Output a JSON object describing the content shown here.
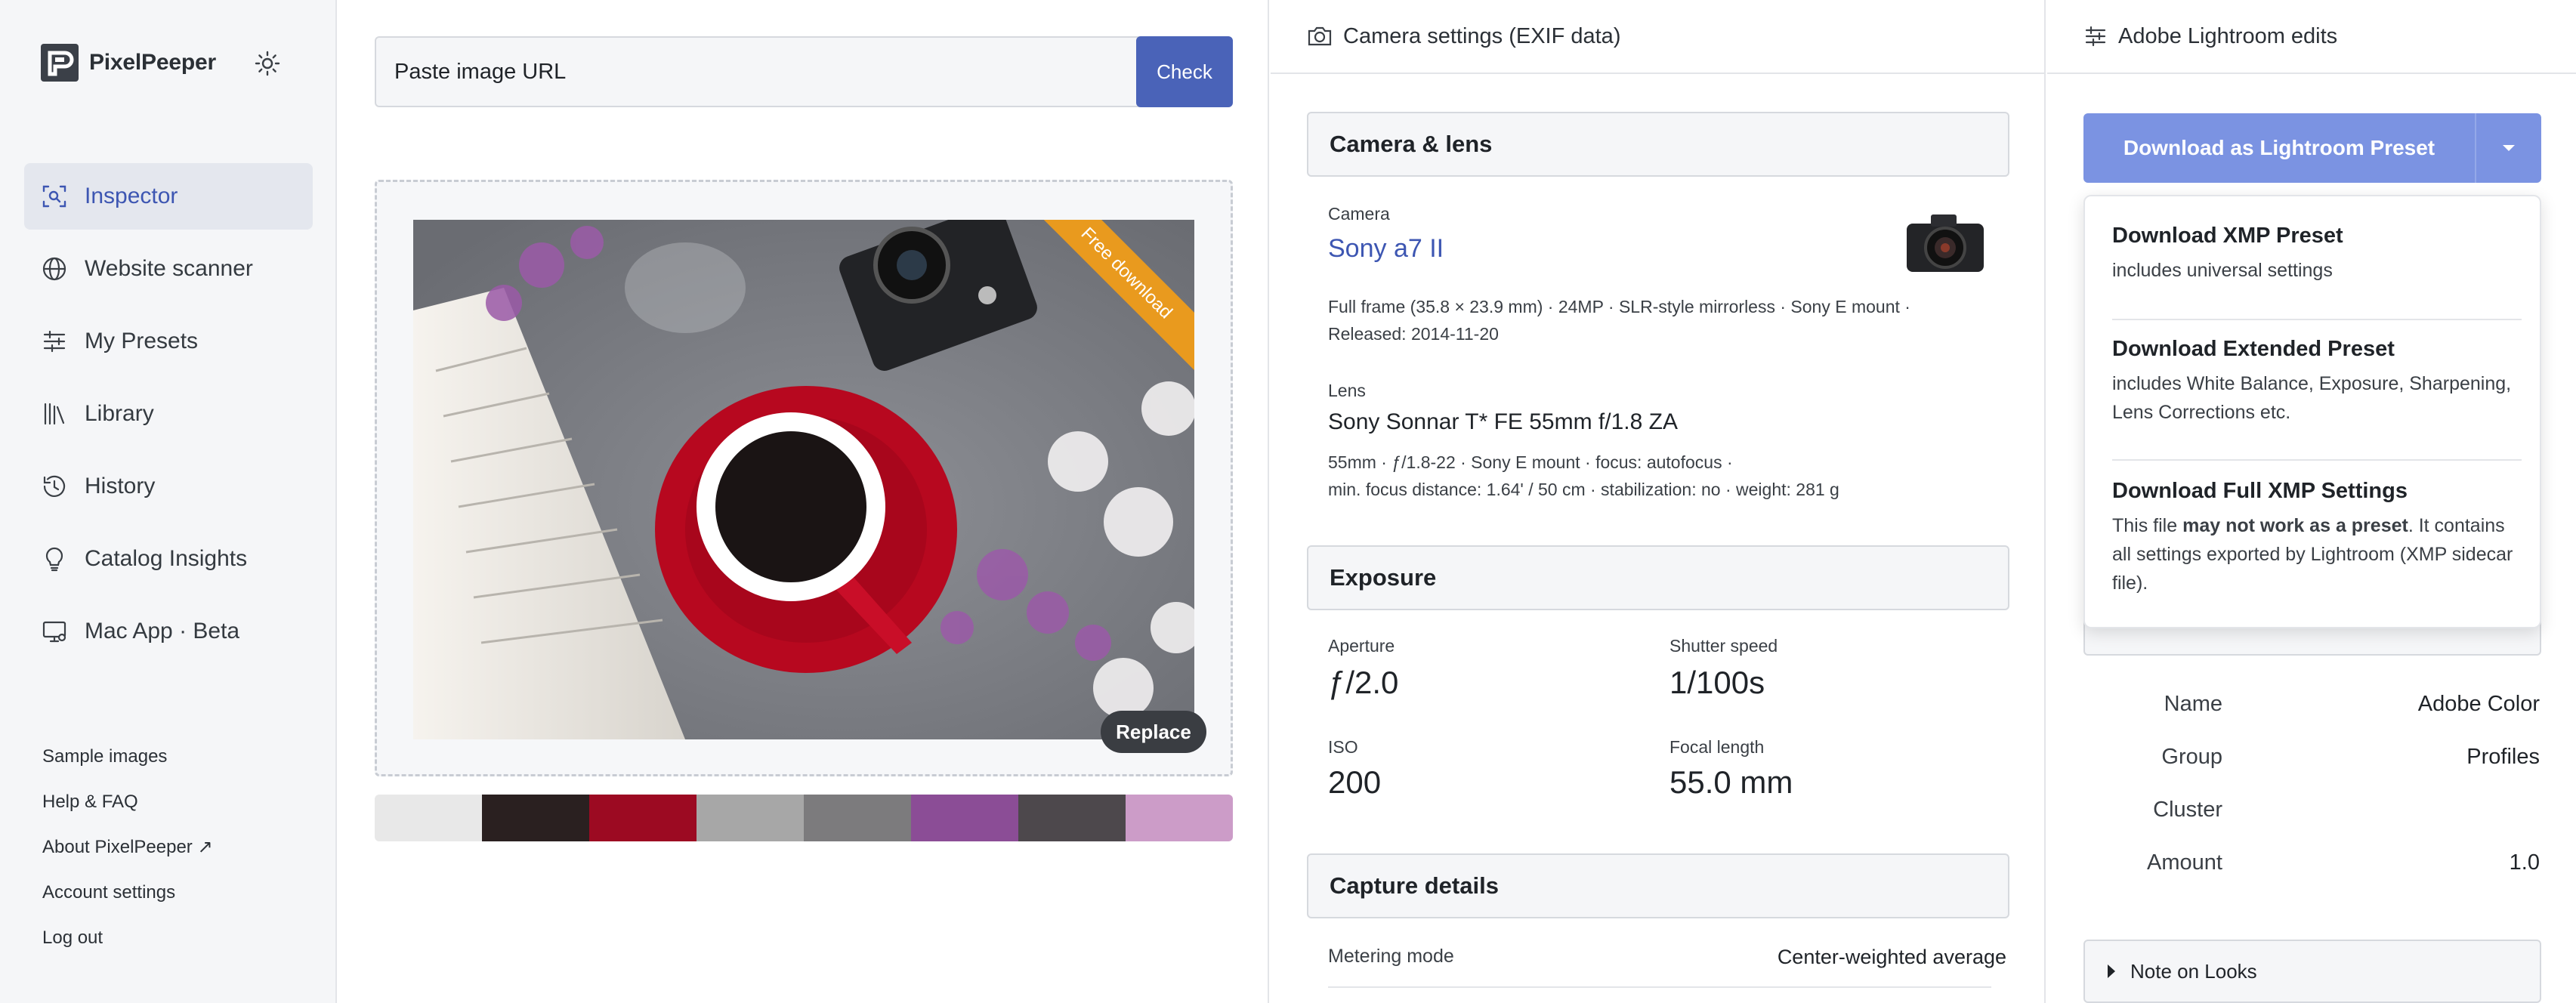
{
  "brand": {
    "name": "PixelPeeper"
  },
  "sidebar": {
    "items": [
      {
        "label": "Inspector",
        "icon": "inspector-icon",
        "active": true
      },
      {
        "label": "Website scanner",
        "icon": "globe-icon",
        "active": false
      },
      {
        "label": "My Presets",
        "icon": "sliders-icon",
        "active": false
      },
      {
        "label": "Library",
        "icon": "library-icon",
        "active": false
      },
      {
        "label": "History",
        "icon": "history-icon",
        "active": false
      },
      {
        "label": "Catalog Insights",
        "icon": "lightbulb-icon",
        "active": false
      },
      {
        "label": "Mac App · Beta",
        "icon": "monitor-icon",
        "active": false
      }
    ],
    "bottom_links": [
      "Sample images",
      "Help & FAQ",
      "About PixelPeeper ↗",
      "Account settings",
      "Log out"
    ]
  },
  "upload": {
    "url_placeholder": "Paste image URL",
    "check_label": "Check",
    "ribbon_label": "Free download",
    "replace_label": "Replace",
    "palette": [
      "#e8e8e8",
      "#2a2020",
      "#9c0a22",
      "#a7a7a7",
      "#7c7b7d",
      "#8b4d96",
      "#4d484c",
      "#cc9cc8"
    ]
  },
  "exif": {
    "header": "Camera settings (EXIF data)",
    "camera_lens": {
      "title": "Camera & lens",
      "camera_label": "Camera",
      "camera_name": "Sony a7 II",
      "camera_meta_1": "Full frame (35.8 × 23.9 mm)  ·  24MP  ·  SLR-style mirrorless  ·  Sony E mount  ·",
      "camera_meta_2": "Released: 2014-11-20",
      "lens_label": "Lens",
      "lens_name": "Sony Sonnar T* FE 55mm f/1.8 ZA",
      "lens_meta_1": "55mm  ·  ƒ/1.8-22  ·  Sony E mount  ·  focus: autofocus  ·",
      "lens_meta_2": "min. focus distance: 1.64' / 50 cm  ·  stabilization: no  ·  weight: 281 g"
    },
    "exposure": {
      "title": "Exposure",
      "aperture_label": "Aperture",
      "aperture": "ƒ/2.0",
      "shutter_label": "Shutter speed",
      "shutter": "1/100s",
      "iso_label": "ISO",
      "iso": "200",
      "focal_label": "Focal length",
      "focal": "55.0 mm"
    },
    "capture": {
      "title": "Capture details",
      "metering_label": "Metering mode",
      "metering_value": "Center-weighted average"
    }
  },
  "lightroom": {
    "header": "Adobe Lightroom edits",
    "download_label": "Download as Lightroom Preset",
    "dropdown": [
      {
        "title": "Download XMP Preset",
        "desc": "includes universal settings"
      },
      {
        "title": "Download Extended Preset",
        "desc": "includes White Balance, Exposure, Sharpening, Lens Corrections etc."
      },
      {
        "title": "Download Full XMP Settings",
        "desc_pre": "This file ",
        "desc_bold": "may not work as a preset",
        "desc_post": ". It contains all settings exported by Lightroom (XMP sidecar file)."
      }
    ],
    "profile": [
      {
        "label": "Name",
        "value": "Adobe Color"
      },
      {
        "label": "Group",
        "value": "Profiles"
      },
      {
        "label": "Cluster",
        "value": ""
      },
      {
        "label": "Amount",
        "value": "1.0"
      }
    ],
    "note_label": "Note on Looks"
  },
  "colors": {
    "accent": "#3d56b2",
    "button": "#4a63b8",
    "preset_button": "#7b93e2",
    "ribbon": "#e99a1e"
  }
}
